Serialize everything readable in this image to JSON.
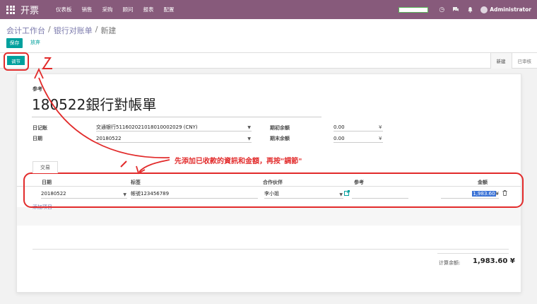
{
  "topbar": {
    "app_name": "开票",
    "menu": [
      "仪表板",
      "销售",
      "采购",
      "顾问",
      "报表",
      "配置"
    ],
    "user": "Administrator"
  },
  "breadcrumb": [
    "会计工作台",
    "银行对账单",
    "新建"
  ],
  "buttons": {
    "save": "保存",
    "discard": "放弃",
    "reconcile": "调节"
  },
  "status_steps": [
    "新建",
    "已审核"
  ],
  "form": {
    "ref_label": "参考",
    "ref_value": "180522銀行對帳單",
    "journal_label": "日记账",
    "journal_value": "交通银行51160202101801000​2029 (CNY)",
    "date_label": "日期",
    "date_value": "20180522",
    "opening_label": "期初余额",
    "opening_value": "0.00",
    "closing_label": "期末余额",
    "closing_value": "0.00",
    "currency": "¥"
  },
  "tab": "交易",
  "list": {
    "headers": [
      "日期",
      "标签",
      "合作伙伴",
      "参考",
      "金额"
    ],
    "row": {
      "date": "20180522",
      "label": "帳號123456789",
      "partner": "李小姐",
      "ref": "",
      "amount": "1,983.60",
      "currency": "¥"
    },
    "add_item": "添加项目"
  },
  "total": {
    "label": "计算余额:",
    "value": "1,983.60 ¥"
  },
  "annotation": {
    "text": "先添加已收款的資訊和金額，再按\"調節\"",
    "mark_1": "1",
    "mark_2": "2",
    "color": "#e22b2b"
  }
}
